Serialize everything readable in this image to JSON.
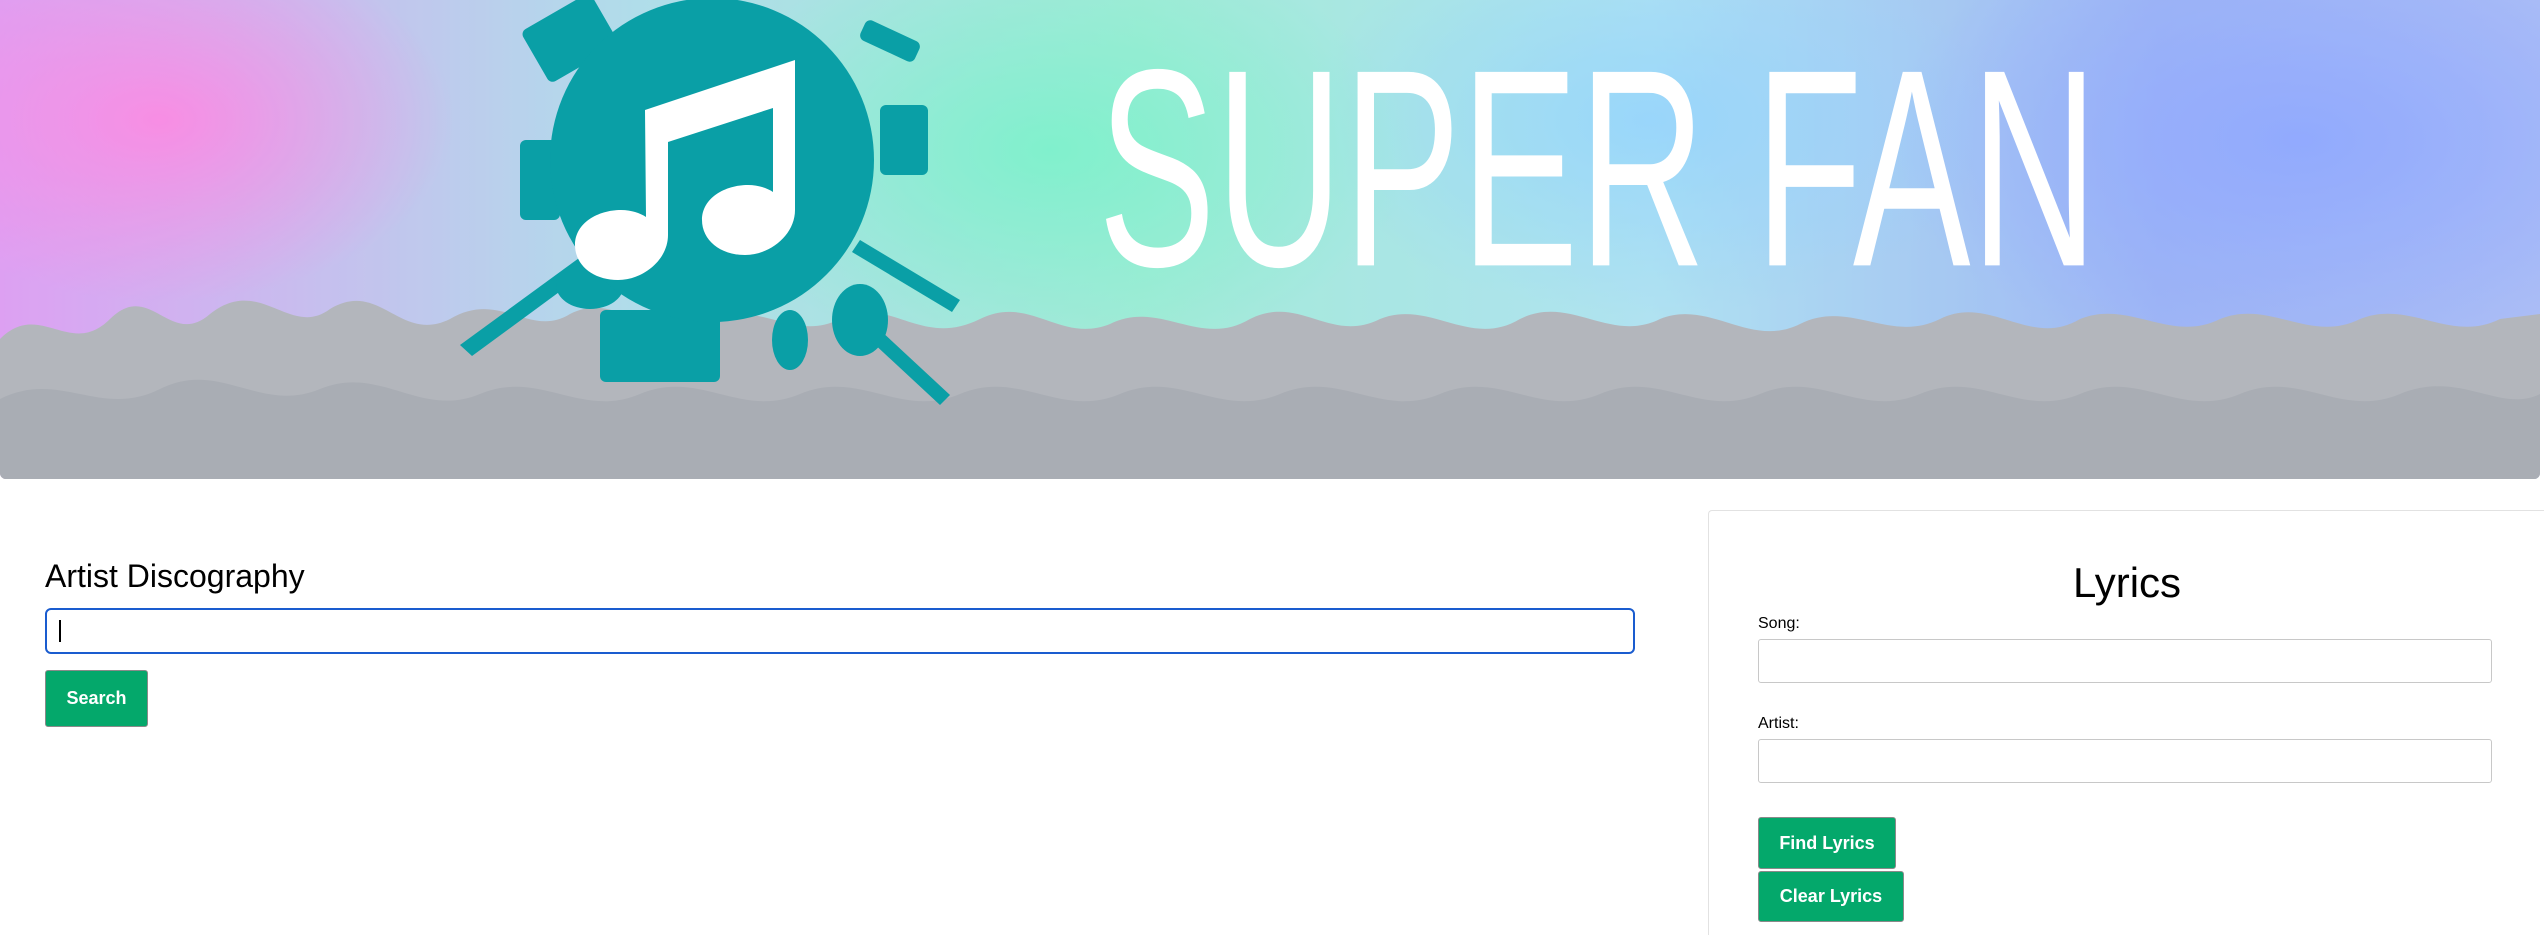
{
  "banner": {
    "logo_alt": "music-note-logo",
    "title_lines": [
      "SUPER FAN"
    ],
    "accent_color": "#0a9fa6"
  },
  "discography": {
    "heading": "Artist Discography",
    "search_value": "",
    "search_button_label": "Search"
  },
  "lyrics": {
    "heading": "Lyrics",
    "song_label": "Song:",
    "song_value": "",
    "artist_label": "Artist:",
    "artist_value": "",
    "find_button_label": "Find Lyrics",
    "clear_button_label": "Clear Lyrics"
  },
  "colors": {
    "button_bg": "#04a86b",
    "focus_border": "#1a5ccf"
  }
}
